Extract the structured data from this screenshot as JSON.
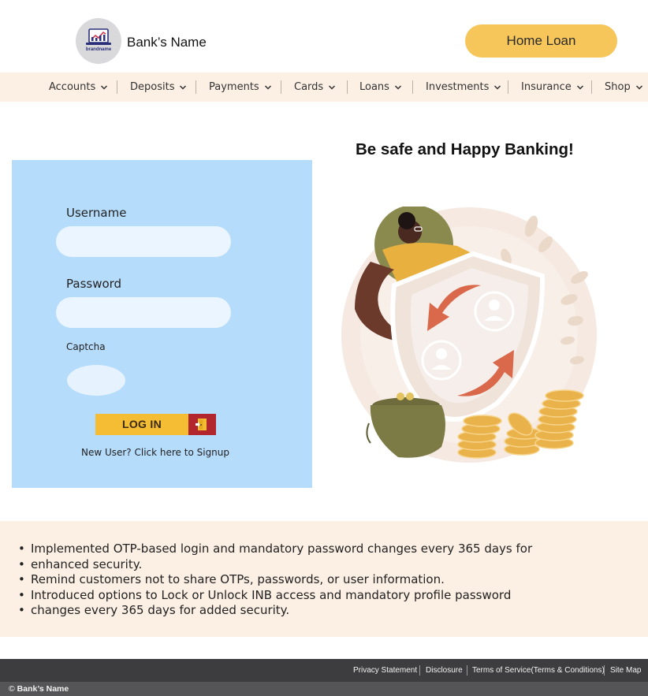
{
  "header": {
    "logo_text": "brandname",
    "bank_name": "Bank’s Name",
    "home_loan_label": "Home Loan"
  },
  "nav": {
    "items": [
      "Accounts",
      "Deposits",
      "Payments",
      "Cards",
      "Loans",
      "Investments",
      "Insurance",
      "Shop"
    ]
  },
  "tagline": "Be safe and Happy Banking!",
  "login": {
    "username_label": "Username",
    "password_label": "Password",
    "captcha_label": "Captcha",
    "login_button": "LOG IN",
    "signup_text": "New User? Click here to Signup"
  },
  "notes": [
    "Implemented OTP-based login and mandatory password changes every 365 days for",
    " enhanced security.",
    "Remind customers not to share OTPs, passwords, or user information.",
    "Introduced options to Lock or Unlock INB access and mandatory profile password",
    "changes every 365 days for added security."
  ],
  "footer": {
    "links": [
      "Privacy Statement",
      "Disclosure",
      "Terms of Service(Terms & Conditions)",
      "Site Map"
    ],
    "copyright_symbol": "©",
    "copyright_name": "Bank’s Name"
  },
  "colors": {
    "accent_yellow": "#f6c65a",
    "nav_bg": "#fcefe4",
    "login_panel_bg": "#b6dcfb",
    "login_btn": "#f4bd34",
    "login_btn_icon": "#b2272d",
    "footer_dark": "#3d3d3f"
  },
  "icons": {
    "nav_chevron": "chevron-down-icon",
    "login_icon": "door-exit-icon",
    "logo": "chart-laptop-logo"
  }
}
